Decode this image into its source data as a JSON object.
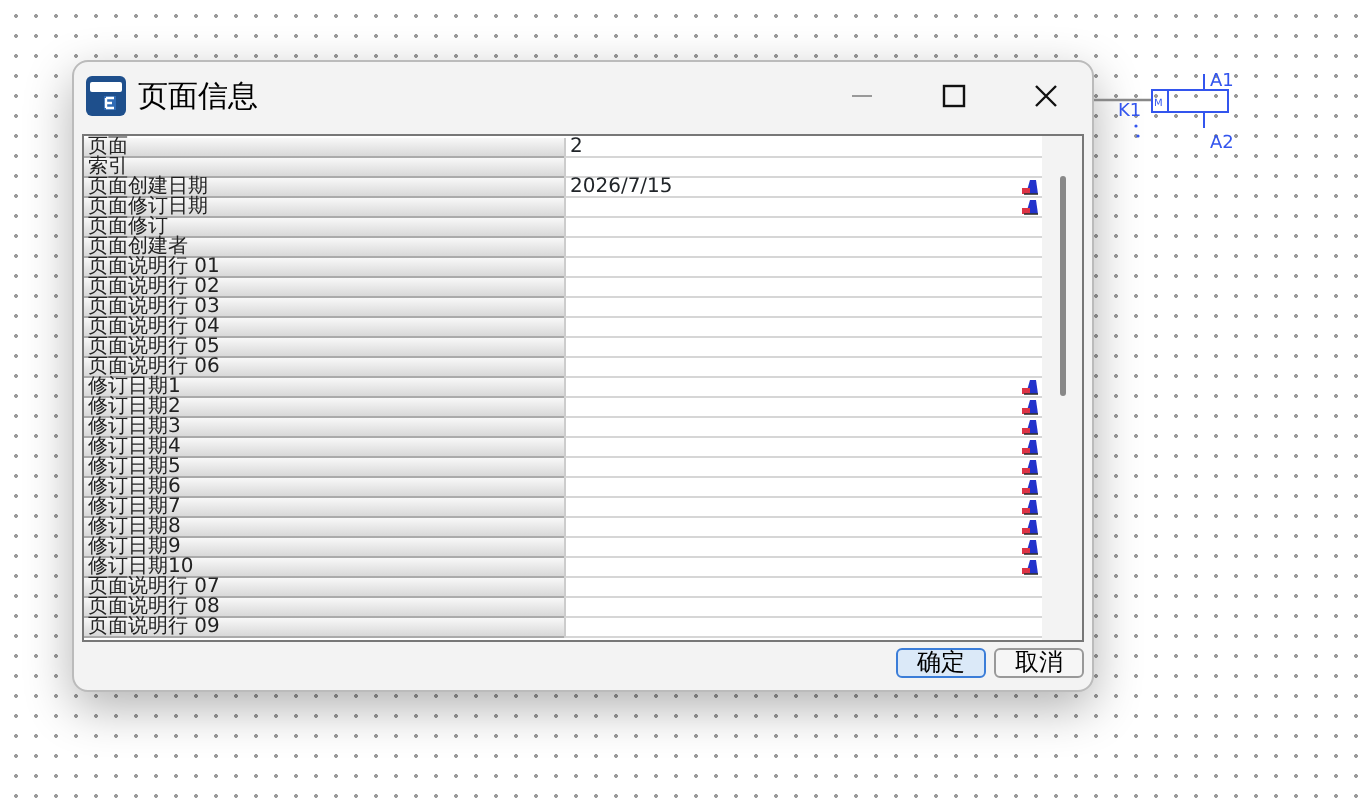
{
  "window": {
    "title": "页面信息"
  },
  "rows": [
    {
      "label": "页面",
      "value": "2",
      "picker": false
    },
    {
      "label": "索引",
      "value": "",
      "picker": false
    },
    {
      "label": "页面创建日期",
      "value": "2026/7/15",
      "picker": true
    },
    {
      "label": "页面修订日期",
      "value": "",
      "picker": true
    },
    {
      "label": "页面修订",
      "value": "",
      "picker": false
    },
    {
      "label": "页面创建者",
      "value": "",
      "picker": false
    },
    {
      "label": "页面说明行 01",
      "value": "",
      "picker": false
    },
    {
      "label": "页面说明行 02",
      "value": "",
      "picker": false
    },
    {
      "label": "页面说明行 03",
      "value": "",
      "picker": false
    },
    {
      "label": "页面说明行 04",
      "value": "",
      "picker": false
    },
    {
      "label": "页面说明行 05",
      "value": "",
      "picker": false
    },
    {
      "label": "页面说明行 06",
      "value": "",
      "picker": false
    },
    {
      "label": "修订日期1",
      "value": "",
      "picker": true
    },
    {
      "label": "修订日期2",
      "value": "",
      "picker": true
    },
    {
      "label": "修订日期3",
      "value": "",
      "picker": true
    },
    {
      "label": "修订日期4",
      "value": "",
      "picker": true
    },
    {
      "label": "修订日期5",
      "value": "",
      "picker": true
    },
    {
      "label": "修订日期6",
      "value": "",
      "picker": true
    },
    {
      "label": "修订日期7",
      "value": "",
      "picker": true
    },
    {
      "label": "修订日期8",
      "value": "",
      "picker": true
    },
    {
      "label": "修订日期9",
      "value": "",
      "picker": true
    },
    {
      "label": "修订日期10",
      "value": "",
      "picker": true
    },
    {
      "label": "页面说明行 07",
      "value": "",
      "picker": false
    },
    {
      "label": "页面说明行 08",
      "value": "",
      "picker": false
    },
    {
      "label": "页面说明行 09",
      "value": "",
      "picker": false
    }
  ],
  "buttons": [
    {
      "label": "确定",
      "default": true
    },
    {
      "label": "取消",
      "default": false
    }
  ],
  "schematic": {
    "device": "K1",
    "pin_top": "A1",
    "pin_bottom": "A2",
    "coil_mark": "M"
  }
}
